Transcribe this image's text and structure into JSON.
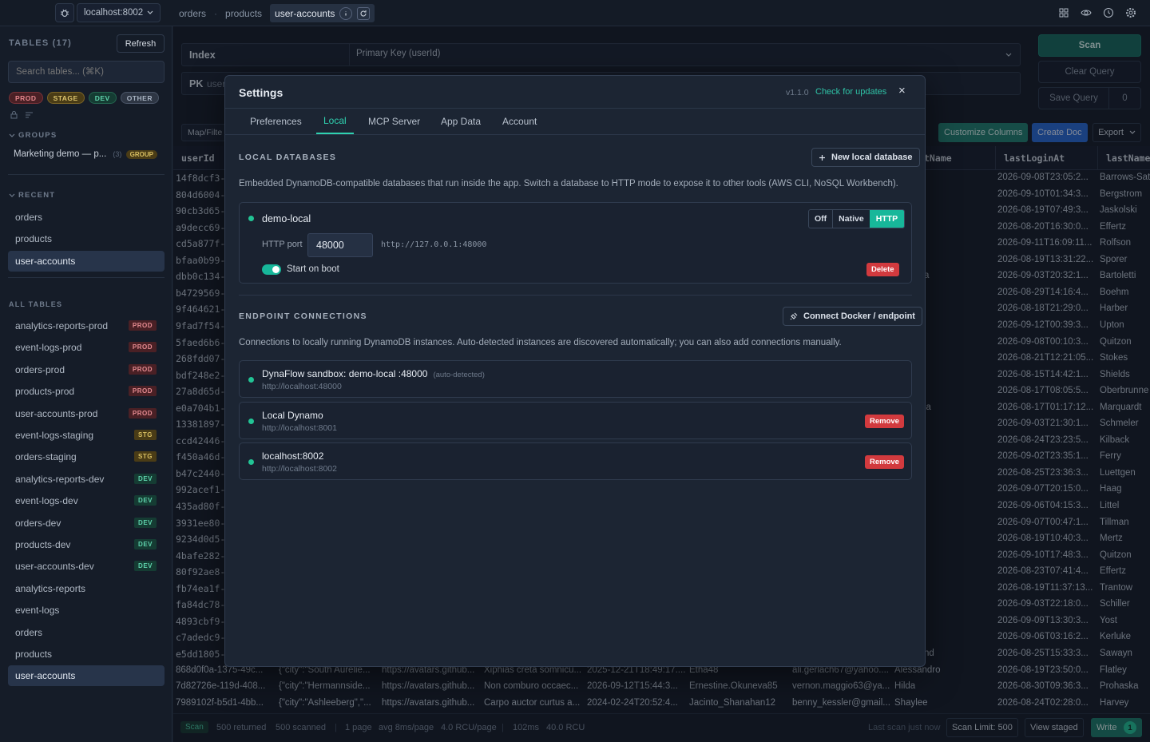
{
  "topbar": {
    "connection": "localhost:8002",
    "crumbs": [
      "orders",
      "products"
    ],
    "active_crumb": "user-accounts"
  },
  "sidebar": {
    "tables_label": "TABLES (17)",
    "refresh_label": "Refresh",
    "search_placeholder": "Search tables... (⌘K)",
    "filters": [
      "PROD",
      "STAGE",
      "DEV",
      "OTHER"
    ],
    "groups_label": "GROUPS",
    "group_item": {
      "name": "Marketing demo — p...",
      "count": "(3)",
      "tag": "GROUP"
    },
    "recent_label": "RECENT",
    "recent": [
      "orders",
      "products",
      "user-accounts"
    ],
    "all_label": "ALL TABLES",
    "all_tables": [
      {
        "name": "analytics-reports-prod",
        "badge": "PROD"
      },
      {
        "name": "event-logs-prod",
        "badge": "PROD"
      },
      {
        "name": "orders-prod",
        "badge": "PROD"
      },
      {
        "name": "products-prod",
        "badge": "PROD"
      },
      {
        "name": "user-accounts-prod",
        "badge": "PROD"
      },
      {
        "name": "event-logs-staging",
        "badge": "STG"
      },
      {
        "name": "orders-staging",
        "badge": "STG"
      },
      {
        "name": "analytics-reports-dev",
        "badge": "DEV"
      },
      {
        "name": "event-logs-dev",
        "badge": "DEV"
      },
      {
        "name": "orders-dev",
        "badge": "DEV"
      },
      {
        "name": "products-dev",
        "badge": "DEV"
      },
      {
        "name": "user-accounts-dev",
        "badge": "DEV"
      },
      {
        "name": "analytics-reports",
        "badge": ""
      },
      {
        "name": "event-logs",
        "badge": ""
      },
      {
        "name": "orders",
        "badge": ""
      },
      {
        "name": "products",
        "badge": ""
      },
      {
        "name": "user-accounts",
        "badge": ""
      }
    ]
  },
  "query": {
    "index_label": "Index",
    "index_value": "Primary Key (userId)",
    "pk_label": "PK",
    "pk_value": "user",
    "map_filter": "Map/Filte",
    "scan_label": "Scan",
    "clear_label": "Clear Query",
    "save_label": "Save Query",
    "save_count": "0"
  },
  "toolbar": {
    "customize": "Customize Columns",
    "create": "Create Doc",
    "export": "Export"
  },
  "grid": {
    "headers": [
      "userId",
      "tName",
      "lastLoginAt",
      "lastName"
    ],
    "rows": [
      {
        "id": "14f8dcf3-a",
        "mid": "",
        "login": "2026-09-08T23:05:2...",
        "last": "Barrows-Sat"
      },
      {
        "id": "804d6004-",
        "mid": "",
        "login": "2026-09-10T01:34:3...",
        "last": "Bergstrom"
      },
      {
        "id": "90cb3d65-",
        "mid": "",
        "login": "2026-08-19T07:49:3...",
        "last": "Jaskolski"
      },
      {
        "id": "a9decc69-",
        "mid": "",
        "login": "2026-08-20T16:30:0...",
        "last": "Effertz"
      },
      {
        "id": "cd5a877f-3",
        "mid": "",
        "login": "2026-09-11T16:09:11...",
        "last": "Rolfson"
      },
      {
        "id": "bfaa0b99-7",
        "mid": "",
        "login": "2026-08-19T13:31:22...",
        "last": "Sporer"
      },
      {
        "id": "dbb0c134-",
        "mid": "a",
        "login": "2026-09-03T20:32:1...",
        "last": "Bartoletti"
      },
      {
        "id": "b4729569-",
        "mid": "",
        "login": "2026-08-29T14:16:4...",
        "last": "Boehm"
      },
      {
        "id": "9f464621-a",
        "mid": "",
        "login": "2026-08-18T21:29:0...",
        "last": "Harber"
      },
      {
        "id": "9fad7f54-8",
        "mid": "",
        "login": "2026-09-12T00:39:3...",
        "last": "Upton"
      },
      {
        "id": "5faed6b6-",
        "mid": "",
        "login": "2026-09-08T00:10:3...",
        "last": "Quitzon"
      },
      {
        "id": "268fdd07-f",
        "mid": "",
        "login": "2026-08-21T12:21:05...",
        "last": "Stokes"
      },
      {
        "id": "bdf248e2-",
        "mid": "",
        "login": "2026-08-15T14:42:1...",
        "last": "Shields"
      },
      {
        "id": "27a8d65d-",
        "mid": "",
        "login": "2026-08-17T08:05:5...",
        "last": "Oberbrunne"
      },
      {
        "id": "e0a704b1-",
        "mid": "ia",
        "login": "2026-08-17T01:17:12...",
        "last": "Marquardt"
      },
      {
        "id": "13381897-a",
        "mid": "",
        "login": "2026-09-03T21:30:1...",
        "last": "Schmeler"
      },
      {
        "id": "ccd42446-",
        "mid": "",
        "login": "2026-08-24T23:23:5...",
        "last": "Kilback"
      },
      {
        "id": "f450a46d-",
        "mid": "",
        "login": "2026-09-02T23:35:1...",
        "last": "Ferry"
      },
      {
        "id": "b47c2440-",
        "mid": "",
        "login": "2026-08-25T23:36:3...",
        "last": "Luettgen"
      },
      {
        "id": "992acef1-c",
        "mid": "",
        "login": "2026-09-07T20:15:0...",
        "last": "Haag"
      },
      {
        "id": "435ad80f-",
        "mid": "",
        "login": "2026-09-06T04:15:3...",
        "last": "Littel"
      },
      {
        "id": "3931ee80-",
        "mid": "",
        "login": "2026-09-07T00:47:1...",
        "last": "Tillman"
      },
      {
        "id": "9234d0d5-",
        "mid": "",
        "login": "2026-08-19T10:40:3...",
        "last": "Mertz"
      },
      {
        "id": "4bafe282-1",
        "mid": "",
        "login": "2026-09-10T17:48:3...",
        "last": "Quitzon"
      },
      {
        "id": "80f92ae8-",
        "mid": "",
        "login": "2026-08-23T07:41:4...",
        "last": "Effertz"
      },
      {
        "id": "fb74ea1f-0",
        "mid": "",
        "login": "2026-08-19T11:37:13...",
        "last": "Trantow"
      },
      {
        "id": "fa84dc78-b",
        "mid": "",
        "login": "2026-09-03T22:18:0...",
        "last": "Schiller"
      },
      {
        "id": "4893cbf9-",
        "mid": "",
        "login": "2026-09-09T13:30:3...",
        "last": "Yost"
      },
      {
        "id": "c7adedc9-",
        "mid": "",
        "login": "2026-09-06T03:16:2...",
        "last": "Kerluke"
      },
      {
        "id": "e5dd1805-",
        "mid": "nd",
        "login": "2026-08-25T15:33:3...",
        "last": "Sawayn"
      }
    ],
    "full_rows": [
      {
        "id": "868d0f0a-1375-49c...",
        "addr": "{\"city\":\"South Aurelie...",
        "avatar": "https://avatars.github...",
        "bio": "Xiphias creta somnicu...",
        "created": "2025-12-21T18:49:17....",
        "user": "Etha48",
        "email": "ali.gerlach67@yahoo....",
        "first": "Alessandro",
        "login": "2026-08-19T23:50:0...",
        "last": "Flatley"
      },
      {
        "id": "7d82726e-119d-408...",
        "addr": "{\"city\":\"Hermannside...",
        "avatar": "https://avatars.github...",
        "bio": "Non comburo occaec...",
        "created": "2026-09-12T15:44:3...",
        "user": "Ernestine.Okuneva85",
        "email": "vernon.maggio63@ya...",
        "first": "Hilda",
        "login": "2026-08-30T09:36:3...",
        "last": "Prohaska"
      },
      {
        "id": "7989102f-b5d1-4bb...",
        "addr": "{\"city\":\"Ashleeberg\",\"...",
        "avatar": "https://avatars.github...",
        "bio": "Carpo auctor curtus a...",
        "created": "2024-02-24T20:52:4...",
        "user": "Jacinto_Shanahan12",
        "email": "benny_kessler@gmail...",
        "first": "Shaylee",
        "login": "2026-08-24T02:28:0...",
        "last": "Harvey"
      }
    ]
  },
  "footer": {
    "mode": "Scan",
    "returned": "500 returned",
    "scanned": "500 scanned",
    "pages": "1 page",
    "avg": "avg 8ms/page",
    "rcu_page": "4.0 RCU/page",
    "time": "102ms",
    "rcu": "40.0 RCU",
    "last_scan": "Last scan just now",
    "limit": "Scan Limit: 500",
    "staged": "View staged",
    "write": "Write",
    "write_count": "1"
  },
  "settings": {
    "title": "Settings",
    "version": "v1.1.0",
    "updates": "Check for updates",
    "tabs": [
      "Preferences",
      "Local",
      "MCP Server",
      "App Data",
      "Account"
    ],
    "local_title": "LOCAL DATABASES",
    "new_db": "New local database",
    "local_desc": "Embedded DynamoDB-compatible databases that run inside the app. Switch a database to HTTP mode to expose it to other tools (AWS CLI, NoSQL Workbench).",
    "db": {
      "name": "demo-local",
      "modes": [
        "Off",
        "Native",
        "HTTP"
      ],
      "port_label": "HTTP port",
      "port": "48000",
      "url": "http://127.0.0.1:48000",
      "boot": "Start on boot",
      "delete": "Delete"
    },
    "endpoint_title": "ENDPOINT CONNECTIONS",
    "connect_btn": "Connect Docker / endpoint",
    "endpoint_desc": "Connections to locally running DynamoDB instances. Auto-detected instances are discovered automatically; you can also add connections manually.",
    "endpoints": [
      {
        "name": "DynaFlow sandbox: demo-local :48000",
        "tag": "(auto-detected)",
        "url": "http://localhost:48000",
        "remove": ""
      },
      {
        "name": "Local Dynamo",
        "tag": "",
        "url": "http://localhost:8001",
        "remove": "Remove"
      },
      {
        "name": "localhost:8002",
        "tag": "",
        "url": "http://localhost:8002",
        "remove": "Remove"
      }
    ],
    "close": "×"
  }
}
